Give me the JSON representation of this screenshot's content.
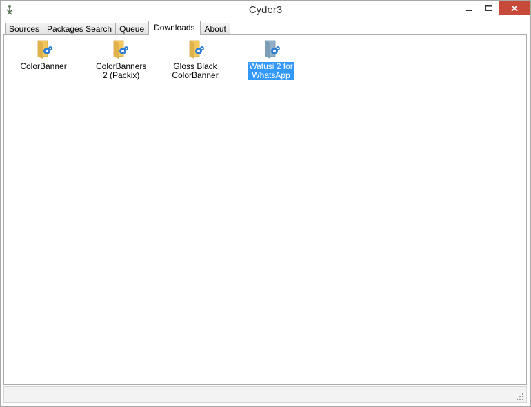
{
  "window": {
    "title": "Cyder3"
  },
  "tabs": [
    {
      "label": "Sources"
    },
    {
      "label": "Packages Search"
    },
    {
      "label": "Queue"
    },
    {
      "label": "Downloads"
    },
    {
      "label": "About"
    }
  ],
  "active_tab": "Downloads",
  "downloads": [
    {
      "line1": "ColorBanner",
      "line2": ""
    },
    {
      "line1": "ColorBanners",
      "line2": "2 (Packix)"
    },
    {
      "line1": "Gloss Black",
      "line2": "ColorBanner"
    },
    {
      "line1": "Watusi 2 for",
      "line2": "WhatsApp"
    }
  ],
  "selected_item": "Watusi 2 for WhatsApp",
  "icons": {
    "item": "folder-gear-icon",
    "app": "cyder-app-icon",
    "minimize": "minimize-icon",
    "maximize": "maximize-icon",
    "close": "close-icon",
    "grip": "resize-grip-icon"
  },
  "colors": {
    "selection": "#3399ff",
    "close_button": "#c7493a",
    "folder": "#f2c75c",
    "gear": "#2f7fd6"
  }
}
